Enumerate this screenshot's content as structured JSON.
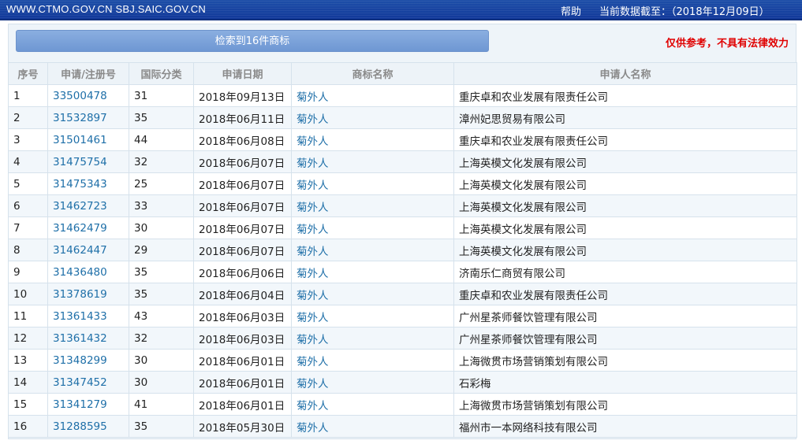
{
  "header": {
    "site_url": "WWW.CTMO.GOV.CN SBJ.SAIC.GOV.CN",
    "help_label": "帮助",
    "data_date": "当前数据截至：（2018年12月09日）"
  },
  "search": {
    "result_text": "检索到16件商标",
    "disclaimer": "仅供参考，不具有法律效力"
  },
  "table": {
    "columns": [
      "序号",
      "申请/注册号",
      "国际分类",
      "申请日期",
      "商标名称",
      "申请人名称"
    ],
    "rows": [
      {
        "no": "1",
        "reg": "33500478",
        "cls": "31",
        "date": "2018年09月13日",
        "name": "菊外人",
        "applicant": "重庆卓和农业发展有限责任公司"
      },
      {
        "no": "2",
        "reg": "31532897",
        "cls": "35",
        "date": "2018年06月11日",
        "name": "菊外人",
        "applicant": "漳州妃思贸易有限公司"
      },
      {
        "no": "3",
        "reg": "31501461",
        "cls": "44",
        "date": "2018年06月08日",
        "name": "菊外人",
        "applicant": "重庆卓和农业发展有限责任公司"
      },
      {
        "no": "4",
        "reg": "31475754",
        "cls": "32",
        "date": "2018年06月07日",
        "name": "菊外人",
        "applicant": "上海英模文化发展有限公司"
      },
      {
        "no": "5",
        "reg": "31475343",
        "cls": "25",
        "date": "2018年06月07日",
        "name": "菊外人",
        "applicant": "上海英模文化发展有限公司"
      },
      {
        "no": "6",
        "reg": "31462723",
        "cls": "33",
        "date": "2018年06月07日",
        "name": "菊外人",
        "applicant": "上海英模文化发展有限公司"
      },
      {
        "no": "7",
        "reg": "31462479",
        "cls": "30",
        "date": "2018年06月07日",
        "name": "菊外人",
        "applicant": "上海英模文化发展有限公司"
      },
      {
        "no": "8",
        "reg": "31462447",
        "cls": "29",
        "date": "2018年06月07日",
        "name": "菊外人",
        "applicant": "上海英模文化发展有限公司"
      },
      {
        "no": "9",
        "reg": "31436480",
        "cls": "35",
        "date": "2018年06月06日",
        "name": "菊外人",
        "applicant": "济南乐仁商贸有限公司"
      },
      {
        "no": "10",
        "reg": "31378619",
        "cls": "35",
        "date": "2018年06月04日",
        "name": "菊外人",
        "applicant": "重庆卓和农业发展有限责任公司"
      },
      {
        "no": "11",
        "reg": "31361433",
        "cls": "43",
        "date": "2018年06月03日",
        "name": "菊外人",
        "applicant": "广州星茶师餐饮管理有限公司"
      },
      {
        "no": "12",
        "reg": "31361432",
        "cls": "32",
        "date": "2018年06月03日",
        "name": "菊外人",
        "applicant": "广州星茶师餐饮管理有限公司"
      },
      {
        "no": "13",
        "reg": "31348299",
        "cls": "30",
        "date": "2018年06月01日",
        "name": "菊外人",
        "applicant": "上海微贯市场营销策划有限公司"
      },
      {
        "no": "14",
        "reg": "31347452",
        "cls": "30",
        "date": "2018年06月01日",
        "name": "菊外人",
        "applicant": "石彩梅"
      },
      {
        "no": "15",
        "reg": "31341279",
        "cls": "41",
        "date": "2018年06月01日",
        "name": "菊外人",
        "applicant": "上海微贯市场营销策划有限公司"
      },
      {
        "no": "16",
        "reg": "31288595",
        "cls": "35",
        "date": "2018年05月30日",
        "name": "菊外人",
        "applicant": "福州市一本网络科技有限公司"
      }
    ]
  },
  "colors": {
    "header_blue": "#1e4fa8",
    "link_blue": "#1e6fa8",
    "disclaimer_red": "#e00000",
    "stripe": "#f2f7fb"
  }
}
